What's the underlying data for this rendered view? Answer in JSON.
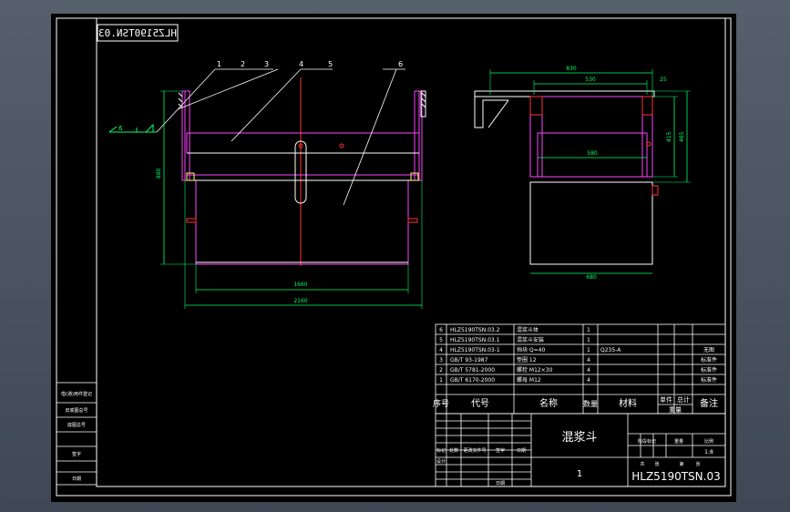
{
  "drawing": {
    "number": "HLZ5190TSN.03",
    "number_mirrored": "HLZ5190TSN.03",
    "title": "混浆斗",
    "sheet_count": "1",
    "scale": "1:8"
  },
  "balloons": [
    "1",
    "2",
    "3",
    "4",
    "5",
    "6"
  ],
  "weld_symbol_label": "6",
  "dimensions": {
    "front_width_inner": "1660",
    "front_width_outer": "2160",
    "front_height": "880",
    "side_top_total": "830",
    "side_top_inner": "530",
    "side_top_right": "25",
    "side_mid": "580",
    "side_bottom": "680",
    "side_height_inner": "415",
    "side_height_outer": "465"
  },
  "bom": {
    "rows": [
      {
        "no": "6",
        "code": "HLZ5190TSN.03.2",
        "name": "混浆斗体",
        "qty": "1",
        "material": "",
        "weight": "",
        "note": ""
      },
      {
        "no": "5",
        "code": "HLZ5190TSN.03.1",
        "name": "混浆斗安装",
        "qty": "1",
        "material": "",
        "weight": "",
        "note": ""
      },
      {
        "no": "4",
        "code": "HLZ5190TSN.03-1",
        "name": "挡块 Q=40",
        "qty": "1",
        "material": "Q235-A",
        "weight": "",
        "note": "无图"
      },
      {
        "no": "3",
        "code": "GB/T 93-1987",
        "name": "垫圈 12",
        "qty": "4",
        "material": "",
        "weight": "",
        "note": "标准件"
      },
      {
        "no": "2",
        "code": "GB/T 5781-2000",
        "name": "螺栓 M12×30",
        "qty": "4",
        "material": "",
        "weight": "",
        "note": "标准件"
      },
      {
        "no": "1",
        "code": "GB/T 6170-2000",
        "name": "螺母 M12",
        "qty": "4",
        "material": "",
        "weight": "",
        "note": "标准件"
      }
    ],
    "header": {
      "no": "序号",
      "code": "代号",
      "name": "名称",
      "qty": "数量",
      "material": "材料",
      "unit": "单件",
      "total": "总计",
      "weight": "重量",
      "note": "备注"
    }
  },
  "title_block": {
    "labels": [
      "标记",
      "处数",
      "更改文件号",
      "签字",
      "日期"
    ],
    "design": "设计",
    "date_label": "日期",
    "stage_labels": [
      "阶段标记",
      "重量",
      "比例"
    ],
    "sheet_labels": [
      "共",
      "张",
      "第",
      "张"
    ]
  },
  "left_strip": {
    "rows": [
      "借(通)用件登记",
      "旧底图总号",
      "底图总号",
      "签字",
      "日期"
    ]
  }
}
